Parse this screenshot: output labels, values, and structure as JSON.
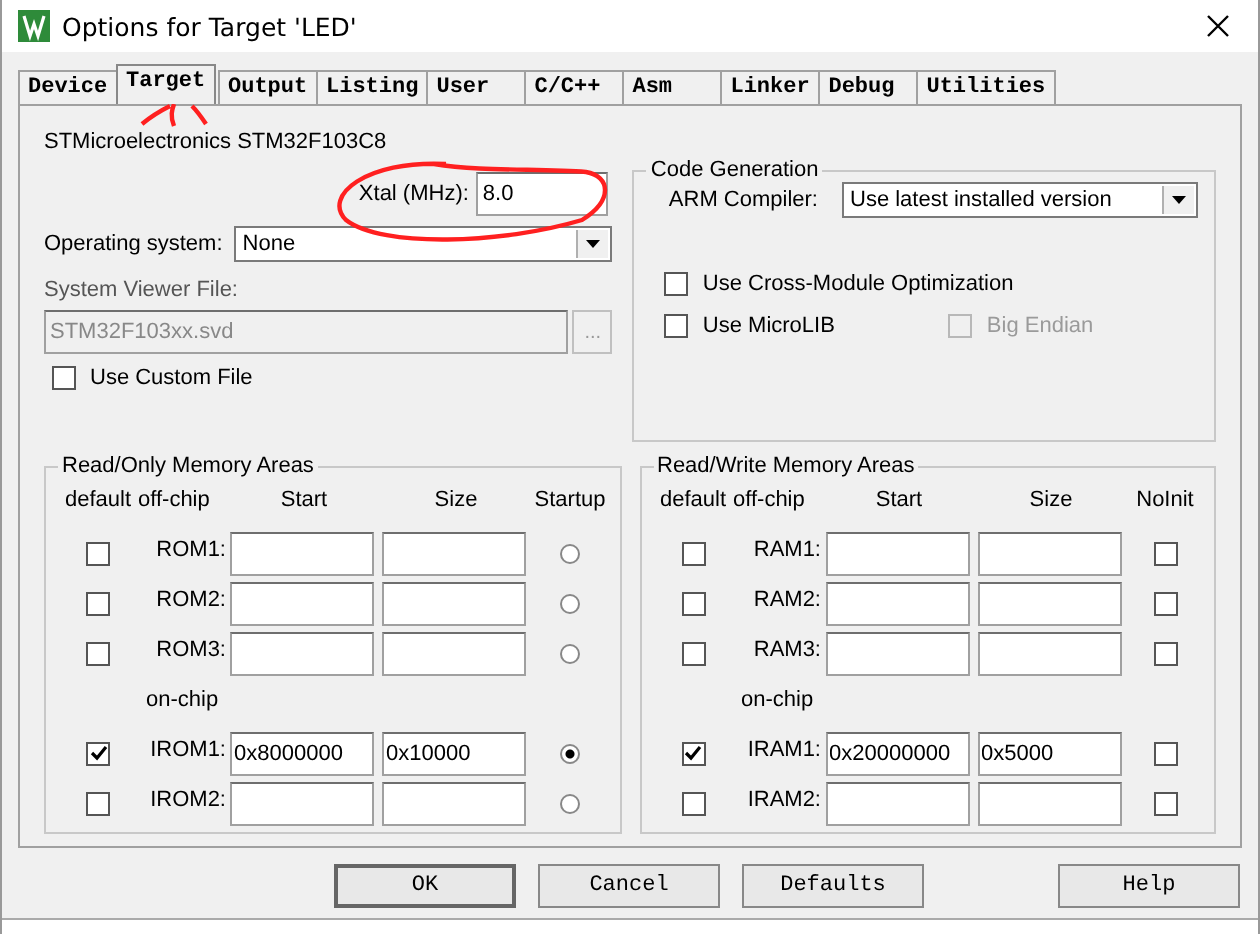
{
  "window": {
    "title": "Options for Target 'LED'"
  },
  "tabs": [
    {
      "label": "Device",
      "selected": false
    },
    {
      "label": "Target",
      "selected": true
    },
    {
      "label": "Output",
      "selected": false
    },
    {
      "label": "Listing",
      "selected": false
    },
    {
      "label": "User",
      "selected": false
    },
    {
      "label": "C/C++",
      "selected": false
    },
    {
      "label": "Asm",
      "selected": false
    },
    {
      "label": "Linker",
      "selected": false
    },
    {
      "label": "Debug",
      "selected": false
    },
    {
      "label": "Utilities",
      "selected": false
    }
  ],
  "device": "STMicroelectronics STM32F103C8",
  "xtal": {
    "label": "Xtal (MHz):",
    "value": "8.0"
  },
  "operating_system": {
    "label": "Operating system:",
    "value": "None"
  },
  "system_viewer_file": {
    "label": "System Viewer File:",
    "value": "STM32F103xx.svd",
    "disabled": true,
    "browse_button": "..."
  },
  "use_custom_file": {
    "label": "Use Custom File",
    "checked": false
  },
  "code_generation": {
    "title": "Code Generation",
    "compiler_label": "ARM Compiler:",
    "compiler_value": "Use latest installed version",
    "options": [
      {
        "label": "Use Cross-Module Optimization",
        "checked": false,
        "disabled": false
      },
      {
        "label": "Use MicroLIB",
        "checked": false,
        "disabled": false
      },
      {
        "label": "Big Endian",
        "checked": false,
        "disabled": true
      }
    ]
  },
  "memory_groups": [
    {
      "title": "Read/Only Memory Areas",
      "columns": [
        "default",
        "off-chip",
        "Start",
        "Size",
        "Startup"
      ],
      "rows": [
        {
          "kind": "memory",
          "label": "ROM1:",
          "default": false,
          "startup": false
        },
        {
          "kind": "memory",
          "label": "ROM2:",
          "default": false,
          "startup": false
        },
        {
          "kind": "memory",
          "label": "ROM3:",
          "default": false,
          "startup": false
        },
        {
          "kind": "heading",
          "label": "on-chip"
        },
        {
          "kind": "memory",
          "label": "IROM1:",
          "default": true,
          "start": "0x8000000",
          "size": "0x10000",
          "startup": true
        },
        {
          "kind": "memory",
          "label": "IROM2:",
          "default": false,
          "startup": false
        }
      ]
    },
    {
      "title": "Read/Write Memory Areas",
      "columns": [
        "default",
        "off-chip",
        "Start",
        "Size",
        "NoInit"
      ],
      "rows": [
        {
          "kind": "memory",
          "label": "RAM1:",
          "default": false,
          "no_init": false
        },
        {
          "kind": "memory",
          "label": "RAM2:",
          "default": false,
          "no_init": false
        },
        {
          "kind": "memory",
          "label": "RAM3:",
          "default": false,
          "no_init": false
        },
        {
          "kind": "heading",
          "label": "on-chip"
        },
        {
          "kind": "memory",
          "label": "IRAM1:",
          "default": true,
          "start": "0x20000000",
          "size": "0x5000",
          "no_init": false
        },
        {
          "kind": "memory",
          "label": "IRAM2:",
          "default": false,
          "no_init": false
        }
      ]
    }
  ],
  "buttons": [
    "OK",
    "Cancel",
    "Defaults",
    "Help"
  ]
}
